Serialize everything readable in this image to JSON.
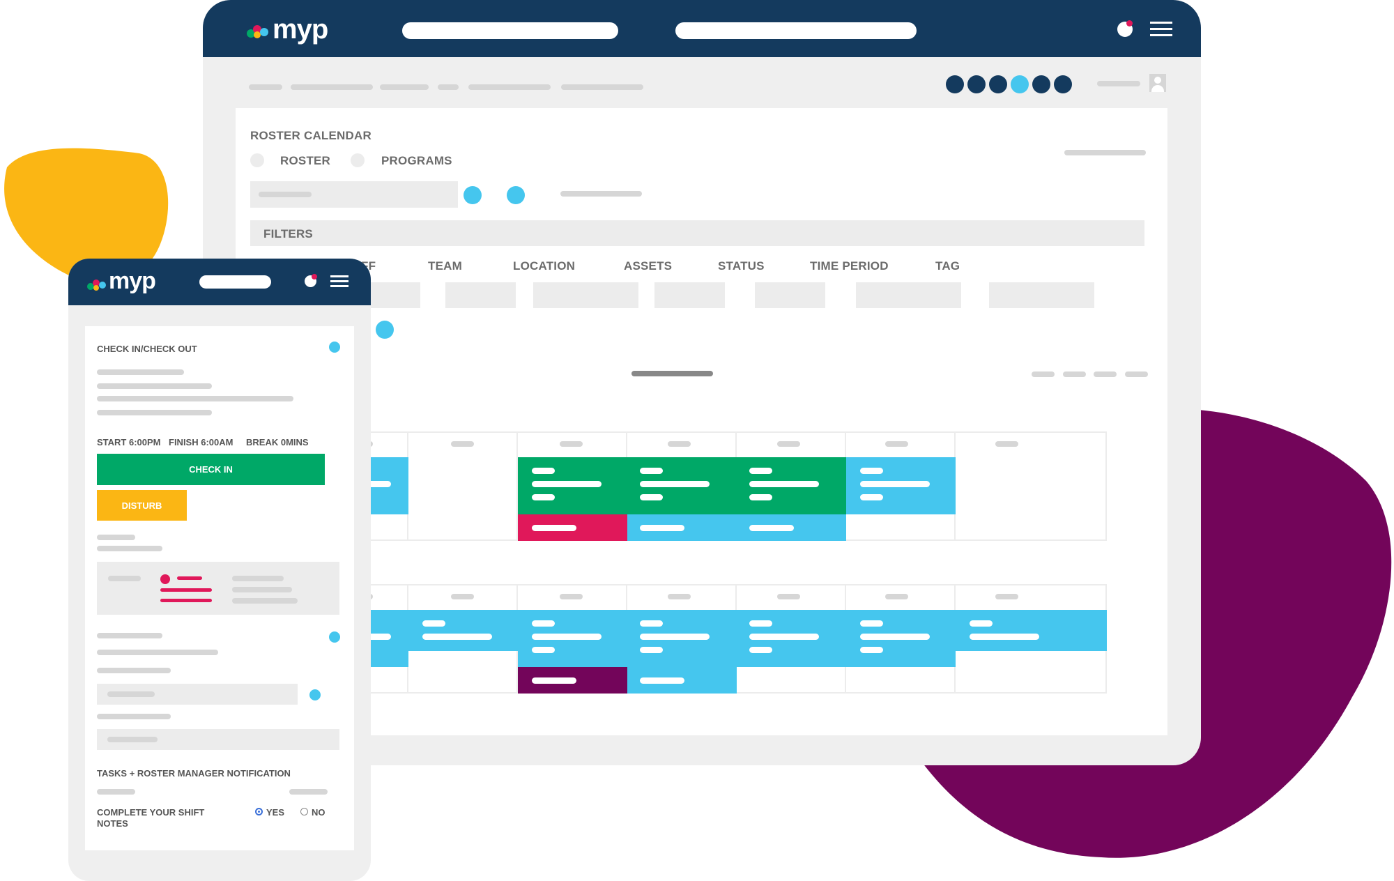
{
  "colors": {
    "navy": "#143a5e",
    "cyan": "#45c6ee",
    "green": "#00a867",
    "crimson": "#e0185a",
    "purple": "#73055a",
    "yellow": "#fbb614",
    "grey_panel": "#efefef"
  },
  "brand": {
    "logo_text": "myp"
  },
  "desktop": {
    "header_icons": [
      "notification-icon",
      "menu-icon"
    ],
    "roster": {
      "title": "ROSTER CALENDAR",
      "view_options": [
        "ROSTER",
        "PROGRAMS"
      ]
    },
    "filters": {
      "heading": "FILTERS",
      "columns": [
        "STAFF",
        "TEAM",
        "LOCATION",
        "ASSETS",
        "STATUS",
        "TIME PERIOD",
        "TAG"
      ],
      "first_column_visible": "FF"
    }
  },
  "mobile": {
    "section_title": "CHECK IN/CHECK OUT",
    "shift_start": "START 6:00PM",
    "shift_finish": "FINISH 6:00AM",
    "shift_break": "BREAK  0MINS",
    "checkin_button": "CHECK IN",
    "disturb_button": "DISTURB",
    "tasks_heading": "TASKS + ROSTER MANAGER NOTIFICATION",
    "shift_notes_question": "COMPLETE YOUR SHIFT NOTES",
    "options": {
      "yes": "YES",
      "no": "NO",
      "selected": "YES"
    }
  }
}
